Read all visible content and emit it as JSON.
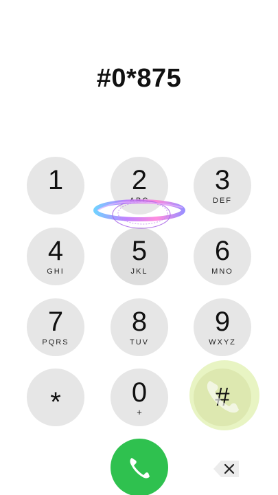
{
  "display": {
    "number": "#0*875"
  },
  "keys": [
    {
      "digit": "1",
      "letters": ""
    },
    {
      "digit": "2",
      "letters": "ABC"
    },
    {
      "digit": "3",
      "letters": "DEF"
    },
    {
      "digit": "4",
      "letters": "GHI"
    },
    {
      "digit": "5",
      "letters": "JKL"
    },
    {
      "digit": "6",
      "letters": "MNO"
    },
    {
      "digit": "7",
      "letters": "PQRS"
    },
    {
      "digit": "8",
      "letters": "TUV"
    },
    {
      "digit": "9",
      "letters": "WXYZ"
    },
    {
      "digit": "*",
      "letters": ""
    },
    {
      "digit": "0",
      "letters": "+"
    },
    {
      "digit": "#",
      "letters": ""
    }
  ],
  "actions": {
    "call_icon": "phone-icon",
    "delete_icon": "backspace-icon"
  },
  "colors": {
    "key_bg": "#e6e6e6",
    "call_green": "#2fc14f",
    "highlight": "#dde8b0"
  }
}
